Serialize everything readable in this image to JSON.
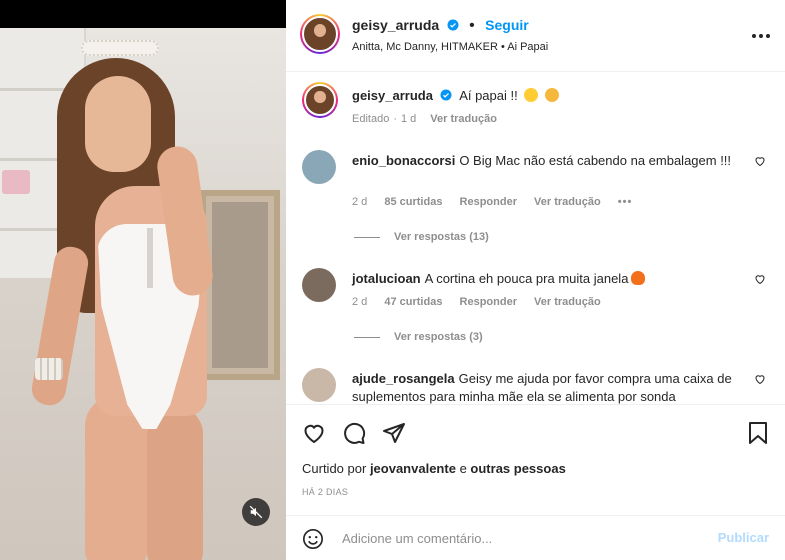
{
  "header": {
    "username": "geisy_arruda",
    "dot": "•",
    "follow_label": "Seguir",
    "audio": "Anitta, Mc Danny, HITMAKER • Ai Papai"
  },
  "caption": {
    "username": "geisy_arruda",
    "text": "Aí papai !!",
    "emojis": [
      "zany-face-emoji",
      "thinking-face-emoji"
    ],
    "edited": "Editado",
    "time": "1 d",
    "translate": "Ver tradução"
  },
  "comments": [
    {
      "username": "enio_bonaccorsi",
      "text": "O Big Mac não está cabendo na embalagem !!!",
      "time": "2 d",
      "likes": "85 curtidas",
      "reply": "Responder",
      "translate": "Ver tradução",
      "more": "•••",
      "replies": "Ver respostas (13)"
    },
    {
      "username": "jotalucioan",
      "text": "A cortina eh pouca pra muita janela",
      "emoji": "fire-emoji",
      "time": "2 d",
      "likes": "47 curtidas",
      "reply": "Responder",
      "translate": "Ver tradução",
      "replies": "Ver respostas (3)"
    },
    {
      "username": "ajude_rosangela",
      "text": "Geisy me ajuda por favor compra uma caixa de suplementos para minha mãe ela se alimenta por sonda"
    }
  ],
  "likes": {
    "prefix": "Curtido por",
    "user": "jeovanvalente",
    "middle": "e",
    "others": "outras pessoas"
  },
  "timestamp": "HÁ 2 DIAS",
  "composer": {
    "placeholder": "Adicione um comentário...",
    "publish_label": "Publicar"
  },
  "colors": {
    "accent": "#0095f6",
    "publish_disabled": "#b3dbff",
    "muted": "#8e8e8e",
    "text": "#262626"
  },
  "icons": {
    "verified": "verified-badge-icon",
    "more": "more-options-icon",
    "like": "heart-icon",
    "comment": "comment-icon",
    "share": "share-icon",
    "save": "bookmark-icon",
    "emoji": "emoji-icon",
    "mute": "muted-speaker-icon"
  }
}
